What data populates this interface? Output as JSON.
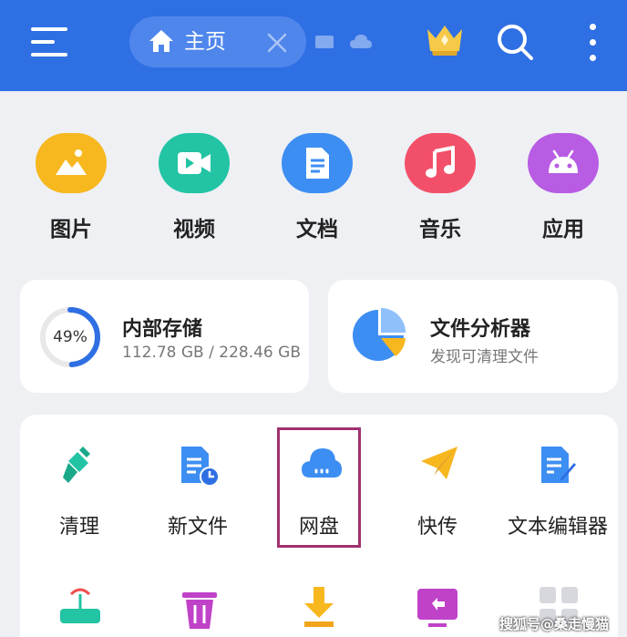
{
  "header": {
    "home_tab_label": "主页",
    "icons": [
      "menu-icon",
      "home-icon",
      "close-icon",
      "crown-icon",
      "search-icon",
      "more-icon"
    ]
  },
  "categories": [
    {
      "label": "图片",
      "color": "#f7b71f",
      "icon": "image-icon"
    },
    {
      "label": "视频",
      "color": "#22c4a4",
      "icon": "video-icon"
    },
    {
      "label": "文档",
      "color": "#3d8ef3",
      "icon": "document-icon"
    },
    {
      "label": "音乐",
      "color": "#f2506a",
      "icon": "music-icon"
    },
    {
      "label": "应用",
      "color": "#b85ce3",
      "icon": "android-icon"
    }
  ],
  "storage": {
    "percent": "49%",
    "used_fraction": 0.49,
    "title": "内部存储",
    "detail": "112.78 GB / 228.46 GB"
  },
  "analyzer": {
    "title": "文件分析器",
    "subtitle": "发现可清理文件"
  },
  "tools": [
    {
      "label": "清理",
      "icon": "broom-icon"
    },
    {
      "label": "新文件",
      "icon": "new-file-icon"
    },
    {
      "label": "网盘",
      "icon": "cloud-icon",
      "highlighted": true
    },
    {
      "label": "快传",
      "icon": "paper-plane-icon"
    },
    {
      "label": "文本编辑器",
      "icon": "text-editor-icon"
    }
  ],
  "tools_row2_icons": [
    "router-icon",
    "trash-icon",
    "download-icon",
    "cast-icon",
    "grid-icon"
  ],
  "watermark": "搜狐号@桑走慢猫",
  "colors": {
    "header": "#2f6fe4",
    "accent": "#3d8ef3",
    "highlight": "#a0306e"
  }
}
